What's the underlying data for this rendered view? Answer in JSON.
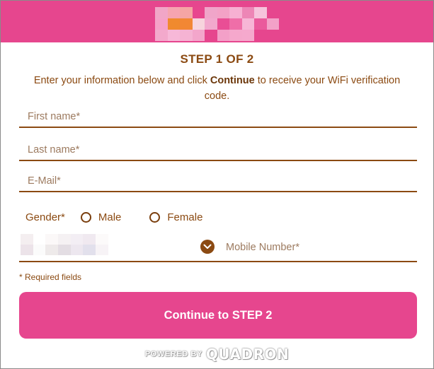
{
  "header": {
    "background_color": "#e6468e",
    "logo_icon": "pixelated-logo",
    "logo_colors": [
      "#f1a6c7",
      "#f6a4b0",
      "#f5a5a4",
      "#e8468e",
      "#f0a5c9",
      "#f3a2c6",
      "#f7b0d2",
      "#ed86b6",
      "#f6c3dc",
      "#e6468e",
      "#f5a2c8",
      "#f08a2e",
      "#f28734",
      "#f7d4dd",
      "#f2a8cd",
      "#e94e95",
      "#ef6ea8",
      "#f7b6d6",
      "#ea5a9c",
      "#f3a1c8",
      "#f3a9cc",
      "#f7b8d8",
      "#f5b3d3",
      "#f3a6cb",
      "#e6468e",
      "#f3a0c8",
      "#f5a8cc",
      "#f5a9cd",
      "#e6468e",
      "#e6468e"
    ]
  },
  "form": {
    "step_title": "STEP 1 OF 2",
    "instructions_before": "Enter your information below and click ",
    "instructions_bold": "Continue",
    "instructions_after": " to receive your WiFi verification code.",
    "first_name_placeholder": "First name*",
    "last_name_placeholder": "Last name*",
    "email_placeholder": "E-Mail*",
    "gender_label": "Gender*",
    "gender_options": [
      "Male",
      "Female"
    ],
    "country_mosaic_colors": [
      "#f4eef0",
      "#ffffff",
      "#fbf8f8",
      "#f5f1f3",
      "#f3eef4",
      "#f0e9f0",
      "#fcfafa",
      "#ece3e9",
      "#fbfbfb",
      "#eeeaea",
      "#e3dde3",
      "#ede7ef",
      "#e2e0ec",
      "#f7f3f6"
    ],
    "country_dropdown_icon": "chevron-down-icon",
    "mobile_placeholder": "Mobile Number*",
    "required_note": "* Required fields",
    "continue_label": "Continue to STEP 2",
    "accent_text_color": "#8b4a12"
  },
  "footer": {
    "powered_by": "POWERED BY",
    "brand": "QUADRON"
  }
}
